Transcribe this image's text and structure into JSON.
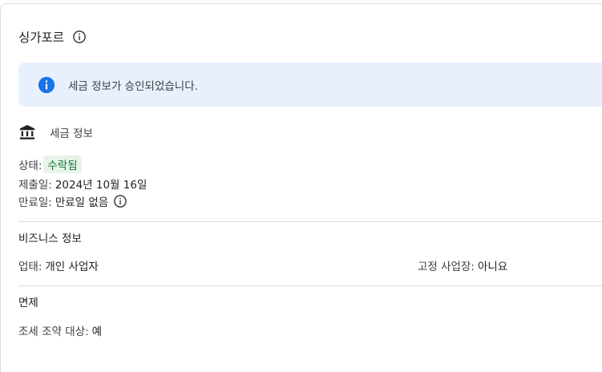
{
  "header": {
    "country": "싱가포르",
    "info_icon": "info-outline-icon"
  },
  "banner": {
    "icon": "info-filled-icon",
    "message": "세금 정보가 승인되었습니다.",
    "background": "#e8f0fe",
    "icon_color": "#1a73e8"
  },
  "tax_section": {
    "icon": "bank-icon",
    "title": "세금 정보",
    "status_label": "상태:",
    "status_value": "수락됨",
    "status_bg": "#e6f4ea",
    "status_color": "#137333",
    "submitted_label": "제출일:",
    "submitted_value": "2024년 10월 16일",
    "expiry_label": "만료일:",
    "expiry_value": "만료일 없음",
    "expiry_info_icon": "info-outline-icon"
  },
  "business_section": {
    "title": "비즈니스 정보",
    "type_label": "업태:",
    "type_value": "개인 사업자",
    "fixed_place_label": "고정 사업장:",
    "fixed_place_value": "아니요"
  },
  "exemption_section": {
    "title": "면제",
    "treaty_label": "조세 조약 대상:",
    "treaty_value": "예"
  }
}
